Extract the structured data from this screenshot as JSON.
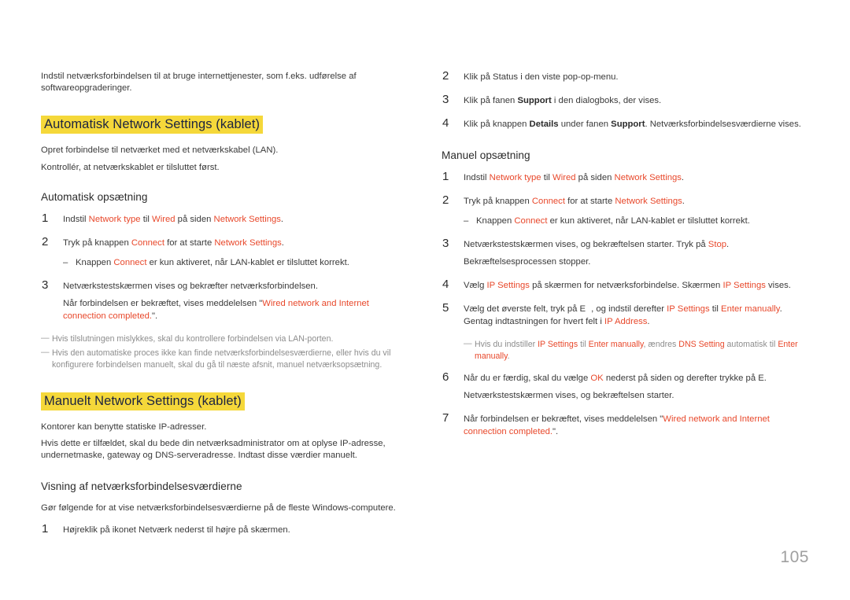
{
  "page": {
    "number": "105",
    "accent_color": "#e8482b",
    "highlight_color": "#f5d83a",
    "heading_text_color": "#1c2340",
    "body_color": "#3a3a3a",
    "note_color": "#8d8d8d"
  },
  "left_column": {
    "intro": "Indstil netværksforbindelsen til at bruge internettjenester, som f.eks. udførelse af softwareopgraderinger.",
    "heading_auto": "Automatisk Network Settings (kablet)",
    "auto_desc_1": "Opret forbindelse til netværket med et netværkskabel (LAN).",
    "auto_desc_2": "Kontrollér, at netværkskablet er tilsluttet først.",
    "subheading_auto_setup": "Automatisk opsætning",
    "step1_num": "1",
    "step1_a": "Indstil ",
    "step1_ui1": "Network type",
    "step1_b": " til ",
    "step1_ui2": "Wired",
    "step1_c": " på siden ",
    "step1_ui3": "Network Settings",
    "step1_d": ".",
    "step2_num": "2",
    "step2_a": "Tryk på knappen ",
    "step2_ui1": "Connect",
    "step2_b": " for at starte ",
    "step2_ui2": "Network Settings",
    "step2_c": ".",
    "step2_dash": "–",
    "step2_dash_a": "Knappen ",
    "step2_dash_ui": "Connect",
    "step2_dash_b": " er kun aktiveret, når LAN-kablet er tilsluttet korrekt.",
    "step3_num": "3",
    "step3_line1": "Netværkstestskærmen vises og bekræfter netværksforbindelsen.",
    "step3_line2_a": "Når forbindelsen er bekræftet, vises meddelelsen \"",
    "step3_line2_ui": "Wired network and Internet connection completed.",
    "step3_line2_b": "\".",
    "note_dash": "—",
    "note1": "Hvis tilslutningen mislykkes, skal du kontrollere forbindelsen via LAN-porten.",
    "note2": "Hvis den automatiske proces ikke kan finde netværksforbindelsesværdierne, eller hvis du vil konfigurere forbindelsen manuelt, skal du gå til næste afsnit, manuel netværksopsætning.",
    "heading_manual": "Manuelt Network Settings (kablet)",
    "manual_desc_1": "Kontorer kan benytte statiske IP-adresser.",
    "manual_desc_2": "Hvis dette er tilfældet, skal du bede din netværksadministrator om at oplyse IP-adresse, undernetmaske, gateway og DNS-serveradresse. Indtast disse værdier manuelt.",
    "subheading_view_values": "Visning af netværksforbindelsesværdierne",
    "view_desc": "Gør følgende for at vise netværksforbindelsesværdierne på de fleste Windows-computere.",
    "view_step1_num": "1",
    "view_step1": "Højreklik på ikonet Netværk nederst til højre på skærmen."
  },
  "right_column": {
    "view_step2_num": "2",
    "view_step2": "Klik på Status i den viste pop-op-menu.",
    "view_step3_num": "3",
    "view_step3_a": "Klik på fanen ",
    "view_step3_strong": "Support",
    "view_step3_b": " i den dialogboks, der vises.",
    "view_step4_num": "4",
    "view_step4_a": "Klik på knappen ",
    "view_step4_strong1": "Details",
    "view_step4_b": " under fanen ",
    "view_step4_strong2": "Support",
    "view_step4_c": ". Netværksforbindelsesværdierne vises.",
    "subheading_manual_setup": "Manuel opsætning",
    "step1_num": "1",
    "step1_a": "Indstil ",
    "step1_ui1": "Network type",
    "step1_b": " til ",
    "step1_ui2": "Wired",
    "step1_c": " på siden ",
    "step1_ui3": "Network Settings",
    "step1_d": ".",
    "step2_num": "2",
    "step2_a": "Tryk på knappen ",
    "step2_ui1": "Connect",
    "step2_b": " for at starte ",
    "step2_ui2": "Network Settings",
    "step2_c": ".",
    "step2_dash": "–",
    "step2_dash_a": "Knappen ",
    "step2_dash_ui": "Connect",
    "step2_dash_b": " er kun aktiveret, når LAN-kablet er tilsluttet korrekt.",
    "step3_num": "3",
    "step3_line1_a": "Netværkstestskærmen vises, og bekræftelsen starter. Tryk på ",
    "step3_line1_ui": "Stop",
    "step3_line1_b": ".",
    "step3_line2": "Bekræftelsesprocessen stopper.",
    "step4_num": "4",
    "step4_a": "Vælg ",
    "step4_ui1": "IP Settings",
    "step4_b": " på skærmen for netværksforbindelse. Skærmen ",
    "step4_ui2": "IP Settings",
    "step4_c": " vises.",
    "step5_num": "5",
    "step5_a": "Vælg det øverste felt, tryk på E",
    "step5_b": ", og indstil derefter ",
    "step5_ui1": "IP Settings",
    "step5_c": " til ",
    "step5_ui2": "Enter manually",
    "step5_d": ". Gentag indtastningen for hvert felt i ",
    "step5_ui3": "IP Address",
    "step5_e": ".",
    "note_dash": "—",
    "note5_a": "Hvis du indstiller ",
    "note5_ui1": "IP Settings",
    "note5_b": " til ",
    "note5_ui2": "Enter manually",
    "note5_c": ", ændres ",
    "note5_ui3": "DNS Setting",
    "note5_d": " automatisk til ",
    "note5_ui4": "Enter manually",
    "note5_e": ".",
    "step6_num": "6",
    "step6_line1_a": "Når du er færdig, skal du vælge ",
    "step6_line1_ui": "OK",
    "step6_line1_b": " nederst på siden og derefter trykke på E.",
    "step6_line2": "Netværkstestskærmen vises, og bekræftelsen starter.",
    "step7_num": "7",
    "step7_a": "Når forbindelsen er bekræftet, vises meddelelsen \"",
    "step7_ui": "Wired network and Internet connection completed.",
    "step7_b": "\"."
  }
}
